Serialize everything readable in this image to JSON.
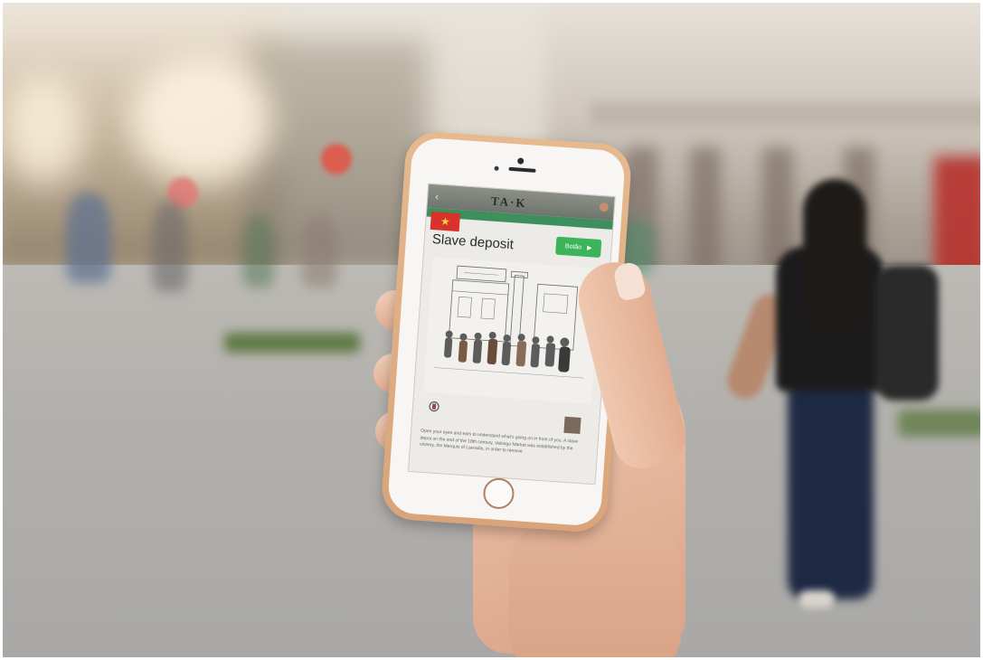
{
  "scene": {
    "description_colors": {
      "phone_case": "#e0b088",
      "app_accent_green": "#3db35a",
      "app_flag_red": "#d7332b",
      "app_header_green": "#3e8f5e"
    }
  },
  "phone_app": {
    "logo_text": "TA·K",
    "page_title": "Slave deposit",
    "language_flag_icon": "vietnam-flag-icon",
    "green_button_label": "Botão",
    "green_button_icon": "play-icon",
    "back_icon": "back-arrow-icon",
    "body_text": "Open your eyes and ears to understand what's going on in front of you. A slave depot on the end of the 18th century, Valongo Market was established by the viceroy, the Marquis of Lavradio, in order to remove"
  }
}
